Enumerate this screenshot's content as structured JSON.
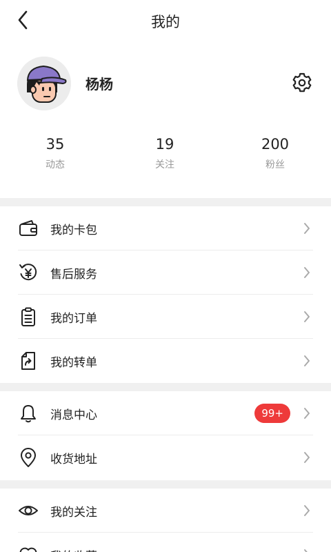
{
  "header": {
    "title": "我的"
  },
  "profile": {
    "username": "杨杨"
  },
  "stats": [
    {
      "value": "35",
      "label": "动态"
    },
    {
      "value": "19",
      "label": "关注"
    },
    {
      "value": "200",
      "label": "粉丝"
    }
  ],
  "menu": {
    "wallet": {
      "label": "我的卡包",
      "icon": "wallet-icon"
    },
    "after_sales": {
      "label": "售后服务",
      "icon": "refund-yen-icon"
    },
    "orders": {
      "label": "我的订单",
      "icon": "clipboard-icon"
    },
    "transfer": {
      "label": "我的转单",
      "icon": "document-share-icon"
    },
    "messages": {
      "label": "消息中心",
      "icon": "bell-icon",
      "badge": "99+"
    },
    "address": {
      "label": "收货地址",
      "icon": "location-pin-icon"
    },
    "follows": {
      "label": "我的关注",
      "icon": "eye-icon"
    },
    "favorites": {
      "label": "我的收藏",
      "icon": "heart-icon"
    }
  },
  "colors": {
    "badge": "#ee3a3a",
    "divider": "#f0f0f0",
    "cap": "#8a78c8"
  }
}
